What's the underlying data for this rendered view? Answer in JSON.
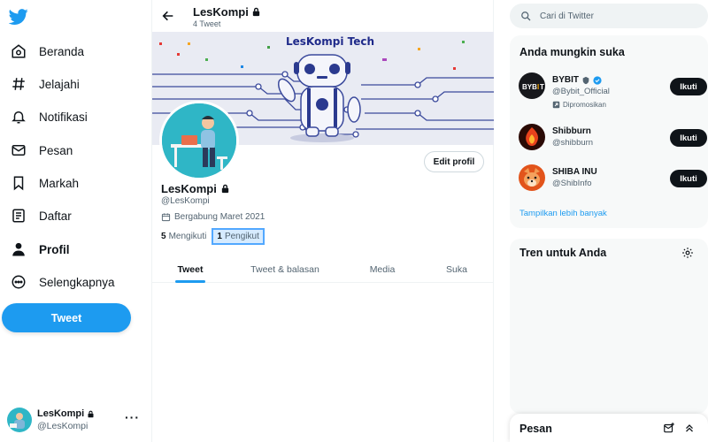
{
  "colors": {
    "accent": "#1d9bf0",
    "text": "#0f1419",
    "muted": "#536471",
    "panel_bg": "#f7f9f9",
    "banner_bg": "#e9ebf3",
    "banner_title": "#1f2a8a",
    "avatar_bg": "#2fb6c6"
  },
  "sidebar": {
    "logo_icon": "twitter-bird-icon",
    "items": [
      {
        "label": "Beranda",
        "icon": "home-icon",
        "active": false
      },
      {
        "label": "Jelajahi",
        "icon": "hashtag-icon",
        "active": false
      },
      {
        "label": "Notifikasi",
        "icon": "bell-icon",
        "active": false
      },
      {
        "label": "Pesan",
        "icon": "envelope-icon",
        "active": false
      },
      {
        "label": "Markah",
        "icon": "bookmark-icon",
        "active": false
      },
      {
        "label": "Daftar",
        "icon": "list-icon",
        "active": false
      },
      {
        "label": "Profil",
        "icon": "person-icon",
        "active": true
      },
      {
        "label": "Selengkapnya",
        "icon": "more-circle-icon",
        "active": false
      }
    ],
    "tweet_button": "Tweet",
    "account": {
      "name": "LesKompi",
      "handle": "@LesKompi",
      "more": "···"
    }
  },
  "profile": {
    "top_title": "LesKompi",
    "tweet_count": "4 Tweet",
    "banner_title": "LesKompi Tech",
    "edit_button": "Edit profil",
    "name": "LesKompi",
    "handle": "@LesKompi",
    "joined": "Bergabung Maret 2021",
    "following_count": "5",
    "following_label": "Mengikuti",
    "followers_count": "1",
    "followers_label": "Pengikut",
    "tabs": [
      {
        "label": "Tweet",
        "active": true
      },
      {
        "label": "Tweet & balasan",
        "active": false
      },
      {
        "label": "Media",
        "active": false
      },
      {
        "label": "Suka",
        "active": false
      }
    ]
  },
  "right": {
    "search_placeholder": "Cari di Twitter",
    "who_title": "Anda mungkin suka",
    "who": [
      {
        "name": "BYBIT",
        "handle": "@Bybit_Official",
        "promoted": "Dipromosikan",
        "button": "Ikuti",
        "verified": true
      },
      {
        "name": "Shibburn",
        "handle": "@shibburn",
        "button": "Ikuti"
      },
      {
        "name": "SHIBA INU",
        "handle": "@ShibInfo",
        "button": "Ikuti"
      }
    ],
    "show_more": "Tampilkan lebih banyak",
    "trends_title": "Tren untuk Anda",
    "messages_title": "Pesan"
  }
}
